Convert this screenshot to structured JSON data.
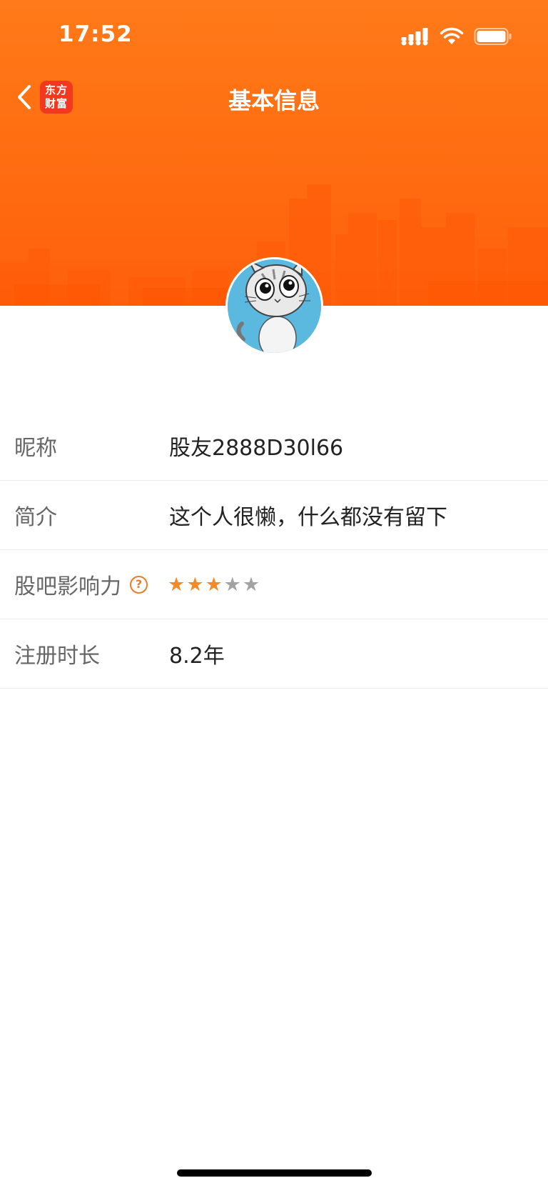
{
  "status_bar": {
    "time": "17:52",
    "icons": [
      "signal-icon",
      "wifi-icon",
      "battery-icon"
    ]
  },
  "nav": {
    "title": "基本信息",
    "logo_line1": "东方",
    "logo_line2": "财富",
    "back_icon": "chevron-left-icon"
  },
  "colors": {
    "banner": "#ff6f12",
    "accent": "#f07a2a",
    "logo": "#f2391f"
  },
  "profile": {
    "rows": [
      {
        "label": "昵称",
        "value": "股友2888D30l66"
      },
      {
        "label": "简介",
        "value": "这个人很懒，什么都没有留下"
      },
      {
        "label": "股吧影响力",
        "help_icon": "question-circle-icon",
        "stars_filled": 3,
        "stars_total": 5
      },
      {
        "label": "注册时长",
        "value": "8.2年"
      }
    ]
  }
}
